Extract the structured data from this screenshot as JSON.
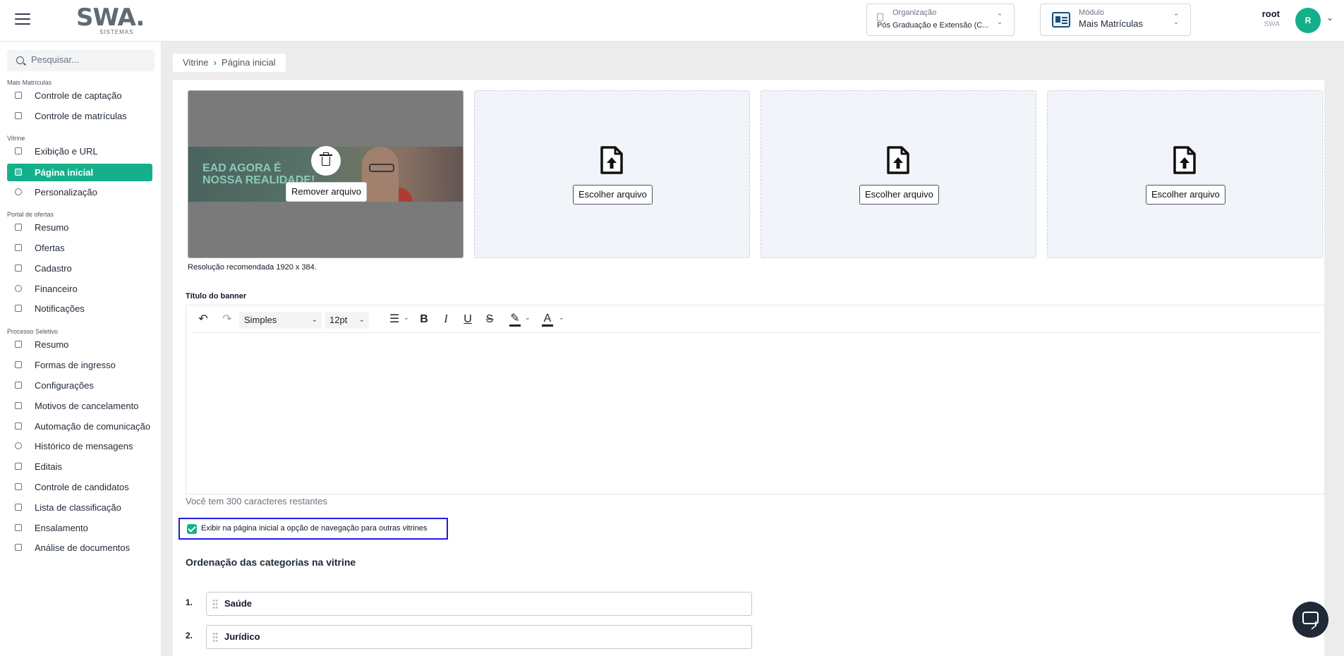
{
  "header": {
    "logo_text": "SWA.",
    "logo_sub": "SISTEMAS",
    "org_label": "Organização",
    "org_value": "Pós Graduação e Extensão (C...",
    "module_label": "Módulo",
    "module_value": "Mais Matrículas",
    "user_name": "root",
    "user_org": "SWA",
    "avatar_initial": "R"
  },
  "sidebar": {
    "search_placeholder": "Pesquisar...",
    "groups": [
      {
        "label": "Mais Matrículas",
        "items": [
          {
            "label": "Controle de captação",
            "icon": "user-plus-icon"
          },
          {
            "label": "Controle de matrículas",
            "icon": "clipboard-icon"
          }
        ]
      },
      {
        "label": "Vitrine",
        "items": [
          {
            "label": "Exibição e URL",
            "icon": "storefront-icon"
          },
          {
            "label": "Página inicial",
            "icon": "grid-icon",
            "active": true
          },
          {
            "label": "Personalização",
            "icon": "palette-icon"
          }
        ]
      },
      {
        "label": "Portal de ofertas",
        "items": [
          {
            "label": "Resumo",
            "icon": "summary-icon"
          },
          {
            "label": "Ofertas",
            "icon": "cart-icon"
          },
          {
            "label": "Cadastro",
            "icon": "user-edit-icon"
          },
          {
            "label": "Financeiro",
            "icon": "dollar-icon"
          },
          {
            "label": "Notificações",
            "icon": "bell-icon"
          }
        ]
      },
      {
        "label": "Processo Seletivo",
        "items": [
          {
            "label": "Resumo",
            "icon": "summary-icon"
          },
          {
            "label": "Formas de ingresso",
            "icon": "id-card-icon"
          },
          {
            "label": "Configurações",
            "icon": "graduation-cap-icon"
          },
          {
            "label": "Motivos de cancelamento",
            "icon": "document-x-icon"
          },
          {
            "label": "Automação de comunicação",
            "icon": "mail-icon"
          },
          {
            "label": "Histórico de mensagens",
            "icon": "whatsapp-icon"
          },
          {
            "label": "Editais",
            "icon": "file-edit-icon"
          },
          {
            "label": "Controle de candidatos",
            "icon": "list-check-icon"
          },
          {
            "label": "Lista de classificação",
            "icon": "ordered-list-icon"
          },
          {
            "label": "Ensalamento",
            "icon": "building-icon"
          },
          {
            "label": "Análise de documentos",
            "icon": "document-search-icon"
          }
        ]
      }
    ]
  },
  "breadcrumb": {
    "parent": "Vitrine",
    "current": "Página inicial"
  },
  "banners": {
    "remove_label": "Remover arquivo",
    "choose_label": "Escolher arquivo",
    "image_text": "EAD AGORA É NOSSA REALIDADE!",
    "resolution_note": "Resolução recomendada 1920 x 384."
  },
  "editor": {
    "label": "Título do banner",
    "font_style": "Simples",
    "font_size": "12pt",
    "chars_remaining": "Você tem 300 caracteres restantes"
  },
  "nav_option": {
    "label": "Exibir na página inicial a opção de navegação para outras vitrines",
    "checked": true
  },
  "categories": {
    "title": "Ordenação das categorias na vitrine",
    "items": [
      {
        "num": "1.",
        "label": "Saúde"
      },
      {
        "num": "2.",
        "label": "Jurídico"
      }
    ]
  },
  "colors": {
    "accent": "#14b08b",
    "highlight_border": "#1d1de0"
  }
}
